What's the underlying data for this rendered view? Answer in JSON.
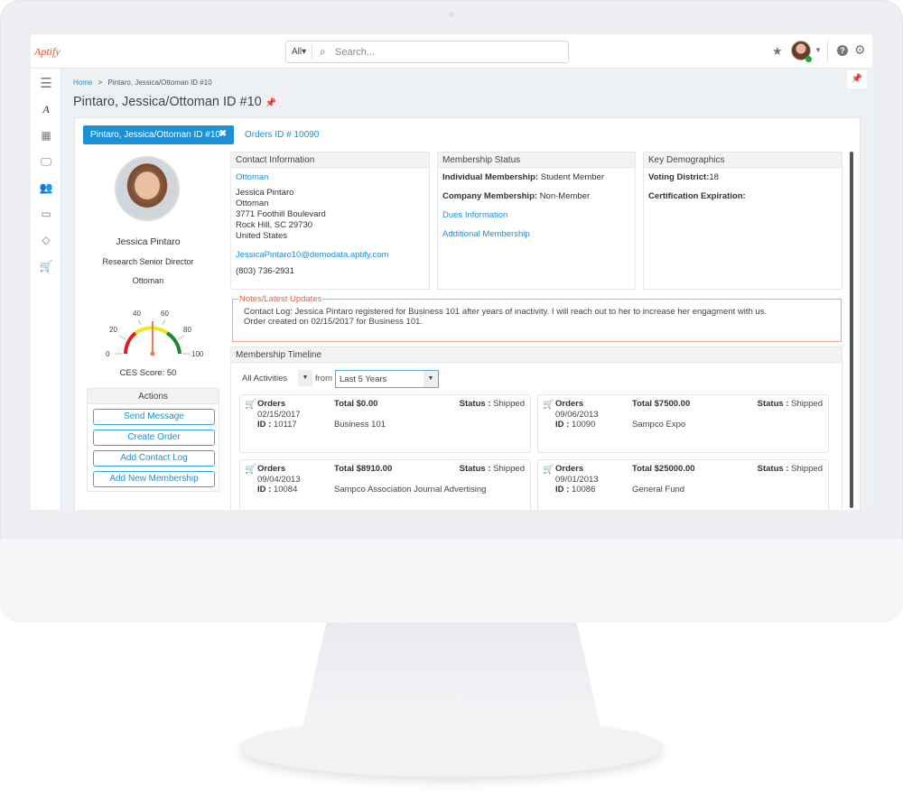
{
  "header": {
    "logo": "Aptify",
    "search_scope": "All",
    "search_placeholder": "Search...",
    "icons": [
      "star-icon",
      "avatar",
      "help-icon",
      "gear-icon"
    ],
    "accent": "#1e90d6"
  },
  "sidebar": {
    "items": [
      "menu-icon",
      "aptify-icon",
      "calculator-icon",
      "monitor-icon",
      "group-icon",
      "card-icon",
      "diamond-icon",
      "cart-icon"
    ]
  },
  "breadcrumb": {
    "home": "Home",
    "sep": ">",
    "current": "Pintaro, Jessica/Ottoman ID #10"
  },
  "page_title": "Pintaro, Jessica/Ottoman ID #10",
  "tabs": [
    {
      "label": "Pintaro, Jessica/Ottoman ID #10",
      "active": true
    },
    {
      "label": "Orders ID # 10090",
      "active": false
    }
  ],
  "profile": {
    "name": "Jessica Pintaro",
    "title": "Research Senior Director",
    "company": "Ottoman",
    "gauge_ticks": [
      "0",
      "20",
      "40",
      "60",
      "80",
      "100"
    ],
    "ces_score_label": "CES Score: 50",
    "ces_score": 50
  },
  "actions": {
    "title": "Actions",
    "buttons": [
      "Send Message",
      "Create Order",
      "Add Contact Log",
      "Add New Membership"
    ]
  },
  "contact": {
    "title": "Contact Information",
    "company_link": "Ottoman",
    "lines": [
      "Jessica Pintaro",
      "Ottoman",
      "3771 Foothill Boulevard",
      "Rock Hill, SC 29730",
      "United States"
    ],
    "email": "JessicaPintaro10@demodata.aptify.com",
    "phone": "(803) 736-2931"
  },
  "membership": {
    "title": "Membership Status",
    "individual_label": "Individual Membership:",
    "individual_value": "Student Member",
    "company_label": "Company Membership:",
    "company_value": "Non-Member",
    "dues_link": "Dues Information",
    "additional_link": "Additional Membership"
  },
  "demographics": {
    "title": "Key Demographics",
    "voting_label": "Voting District:",
    "voting_value": "18",
    "cert_label": "Certification Expiration:"
  },
  "notes": {
    "title": "Notes/Latest Updates",
    "lines": [
      "Contact Log: Jessica Pintaro registered for Business 101 after years of inactivity. I will reach out to her to increase her engagment with us.",
      "Order created on 02/15/2017 for Business 101."
    ]
  },
  "timeline": {
    "title": "Membership Timeline",
    "activity_filter": "All Activities",
    "from_label": "from",
    "range_filter": "Last 5 Years",
    "status_label": "Status :",
    "id_label": "ID :",
    "orders": [
      {
        "type": "Orders",
        "date": "02/15/2017",
        "id": "10117",
        "total": "Total $0.00",
        "desc": "Business 101",
        "status": "Shipped"
      },
      {
        "type": "Orders",
        "date": "09/06/2013",
        "id": "10090",
        "total": "Total $7500.00",
        "desc": "Sampco Expo",
        "status": "Shipped"
      },
      {
        "type": "Orders",
        "date": "09/04/2013",
        "id": "10084",
        "total": "Total $8910.00",
        "desc": "Sampco Association Journal Advertising",
        "status": "Shipped"
      },
      {
        "type": "Orders",
        "date": "09/01/2013",
        "id": "10086",
        "total": "Total $25000.00",
        "desc": "General Fund",
        "status": "Shipped"
      }
    ]
  }
}
